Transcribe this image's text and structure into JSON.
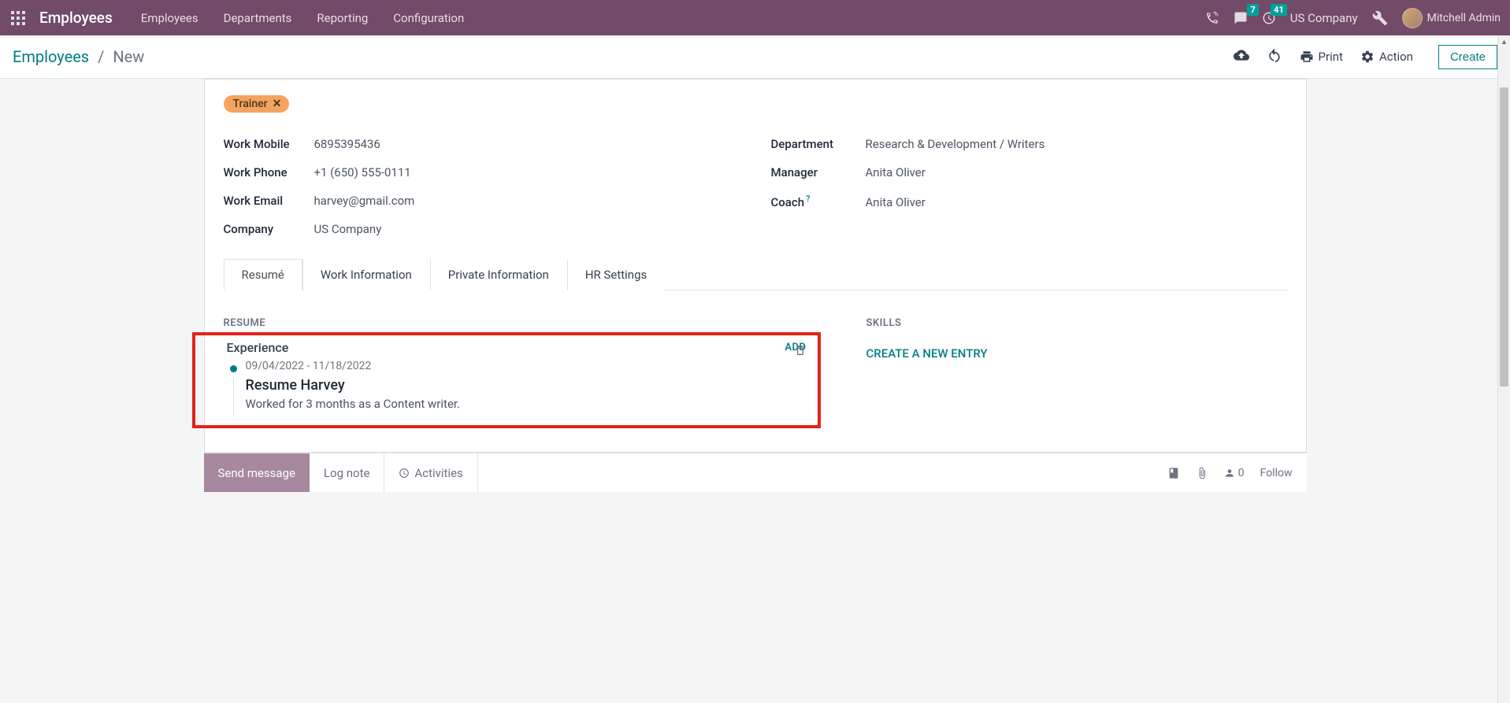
{
  "nav": {
    "brand": "Employees",
    "links": [
      "Employees",
      "Departments",
      "Reporting",
      "Configuration"
    ],
    "messages_badge": "7",
    "activities_badge": "41",
    "company": "US Company",
    "user": "Mitchell Admin"
  },
  "control": {
    "bc_root": "Employees",
    "bc_sep": "/",
    "bc_current": "New",
    "print": "Print",
    "action": "Action",
    "create": "Create"
  },
  "form": {
    "tag": "Trainer",
    "left": {
      "work_mobile_label": "Work Mobile",
      "work_mobile": "6895395436",
      "work_phone_label": "Work Phone",
      "work_phone": "+1 (650) 555-0111",
      "work_email_label": "Work Email",
      "work_email": "harvey@gmail.com",
      "company_label": "Company",
      "company": "US Company"
    },
    "right": {
      "department_label": "Department",
      "department": "Research & Development / Writers",
      "manager_label": "Manager",
      "manager": "Anita Oliver",
      "coach_label": "Coach",
      "coach": "Anita Oliver"
    },
    "tabs": [
      "Resumé",
      "Work Information",
      "Private Information",
      "HR Settings"
    ],
    "resume": {
      "title": "RESUME",
      "experience_header": "Experience",
      "add": "ADD",
      "entry": {
        "dates": "09/04/2022 - 11/18/2022",
        "title": "Resume Harvey",
        "desc": "Worked for 3 months as a Content writer."
      }
    },
    "skills": {
      "title": "SKILLS",
      "create": "CREATE A NEW ENTRY"
    }
  },
  "chatter": {
    "send": "Send message",
    "log": "Log note",
    "activities": "Activities",
    "follower_count": "0",
    "follow": "Follow"
  }
}
